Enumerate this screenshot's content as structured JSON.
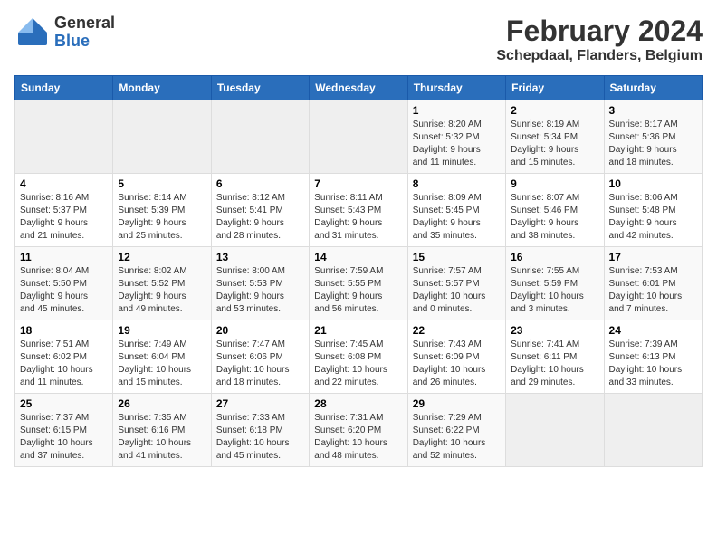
{
  "header": {
    "logo_general": "General",
    "logo_blue": "Blue",
    "main_title": "February 2024",
    "subtitle": "Schepdaal, Flanders, Belgium"
  },
  "calendar": {
    "days_of_week": [
      "Sunday",
      "Monday",
      "Tuesday",
      "Wednesday",
      "Thursday",
      "Friday",
      "Saturday"
    ],
    "weeks": [
      [
        {
          "day": "",
          "info": ""
        },
        {
          "day": "",
          "info": ""
        },
        {
          "day": "",
          "info": ""
        },
        {
          "day": "",
          "info": ""
        },
        {
          "day": "1",
          "info": "Sunrise: 8:20 AM\nSunset: 5:32 PM\nDaylight: 9 hours\nand 11 minutes."
        },
        {
          "day": "2",
          "info": "Sunrise: 8:19 AM\nSunset: 5:34 PM\nDaylight: 9 hours\nand 15 minutes."
        },
        {
          "day": "3",
          "info": "Sunrise: 8:17 AM\nSunset: 5:36 PM\nDaylight: 9 hours\nand 18 minutes."
        }
      ],
      [
        {
          "day": "4",
          "info": "Sunrise: 8:16 AM\nSunset: 5:37 PM\nDaylight: 9 hours\nand 21 minutes."
        },
        {
          "day": "5",
          "info": "Sunrise: 8:14 AM\nSunset: 5:39 PM\nDaylight: 9 hours\nand 25 minutes."
        },
        {
          "day": "6",
          "info": "Sunrise: 8:12 AM\nSunset: 5:41 PM\nDaylight: 9 hours\nand 28 minutes."
        },
        {
          "day": "7",
          "info": "Sunrise: 8:11 AM\nSunset: 5:43 PM\nDaylight: 9 hours\nand 31 minutes."
        },
        {
          "day": "8",
          "info": "Sunrise: 8:09 AM\nSunset: 5:45 PM\nDaylight: 9 hours\nand 35 minutes."
        },
        {
          "day": "9",
          "info": "Sunrise: 8:07 AM\nSunset: 5:46 PM\nDaylight: 9 hours\nand 38 minutes."
        },
        {
          "day": "10",
          "info": "Sunrise: 8:06 AM\nSunset: 5:48 PM\nDaylight: 9 hours\nand 42 minutes."
        }
      ],
      [
        {
          "day": "11",
          "info": "Sunrise: 8:04 AM\nSunset: 5:50 PM\nDaylight: 9 hours\nand 45 minutes."
        },
        {
          "day": "12",
          "info": "Sunrise: 8:02 AM\nSunset: 5:52 PM\nDaylight: 9 hours\nand 49 minutes."
        },
        {
          "day": "13",
          "info": "Sunrise: 8:00 AM\nSunset: 5:53 PM\nDaylight: 9 hours\nand 53 minutes."
        },
        {
          "day": "14",
          "info": "Sunrise: 7:59 AM\nSunset: 5:55 PM\nDaylight: 9 hours\nand 56 minutes."
        },
        {
          "day": "15",
          "info": "Sunrise: 7:57 AM\nSunset: 5:57 PM\nDaylight: 10 hours\nand 0 minutes."
        },
        {
          "day": "16",
          "info": "Sunrise: 7:55 AM\nSunset: 5:59 PM\nDaylight: 10 hours\nand 3 minutes."
        },
        {
          "day": "17",
          "info": "Sunrise: 7:53 AM\nSunset: 6:01 PM\nDaylight: 10 hours\nand 7 minutes."
        }
      ],
      [
        {
          "day": "18",
          "info": "Sunrise: 7:51 AM\nSunset: 6:02 PM\nDaylight: 10 hours\nand 11 minutes."
        },
        {
          "day": "19",
          "info": "Sunrise: 7:49 AM\nSunset: 6:04 PM\nDaylight: 10 hours\nand 15 minutes."
        },
        {
          "day": "20",
          "info": "Sunrise: 7:47 AM\nSunset: 6:06 PM\nDaylight: 10 hours\nand 18 minutes."
        },
        {
          "day": "21",
          "info": "Sunrise: 7:45 AM\nSunset: 6:08 PM\nDaylight: 10 hours\nand 22 minutes."
        },
        {
          "day": "22",
          "info": "Sunrise: 7:43 AM\nSunset: 6:09 PM\nDaylight: 10 hours\nand 26 minutes."
        },
        {
          "day": "23",
          "info": "Sunrise: 7:41 AM\nSunset: 6:11 PM\nDaylight: 10 hours\nand 29 minutes."
        },
        {
          "day": "24",
          "info": "Sunrise: 7:39 AM\nSunset: 6:13 PM\nDaylight: 10 hours\nand 33 minutes."
        }
      ],
      [
        {
          "day": "25",
          "info": "Sunrise: 7:37 AM\nSunset: 6:15 PM\nDaylight: 10 hours\nand 37 minutes."
        },
        {
          "day": "26",
          "info": "Sunrise: 7:35 AM\nSunset: 6:16 PM\nDaylight: 10 hours\nand 41 minutes."
        },
        {
          "day": "27",
          "info": "Sunrise: 7:33 AM\nSunset: 6:18 PM\nDaylight: 10 hours\nand 45 minutes."
        },
        {
          "day": "28",
          "info": "Sunrise: 7:31 AM\nSunset: 6:20 PM\nDaylight: 10 hours\nand 48 minutes."
        },
        {
          "day": "29",
          "info": "Sunrise: 7:29 AM\nSunset: 6:22 PM\nDaylight: 10 hours\nand 52 minutes."
        },
        {
          "day": "",
          "info": ""
        },
        {
          "day": "",
          "info": ""
        }
      ]
    ]
  }
}
